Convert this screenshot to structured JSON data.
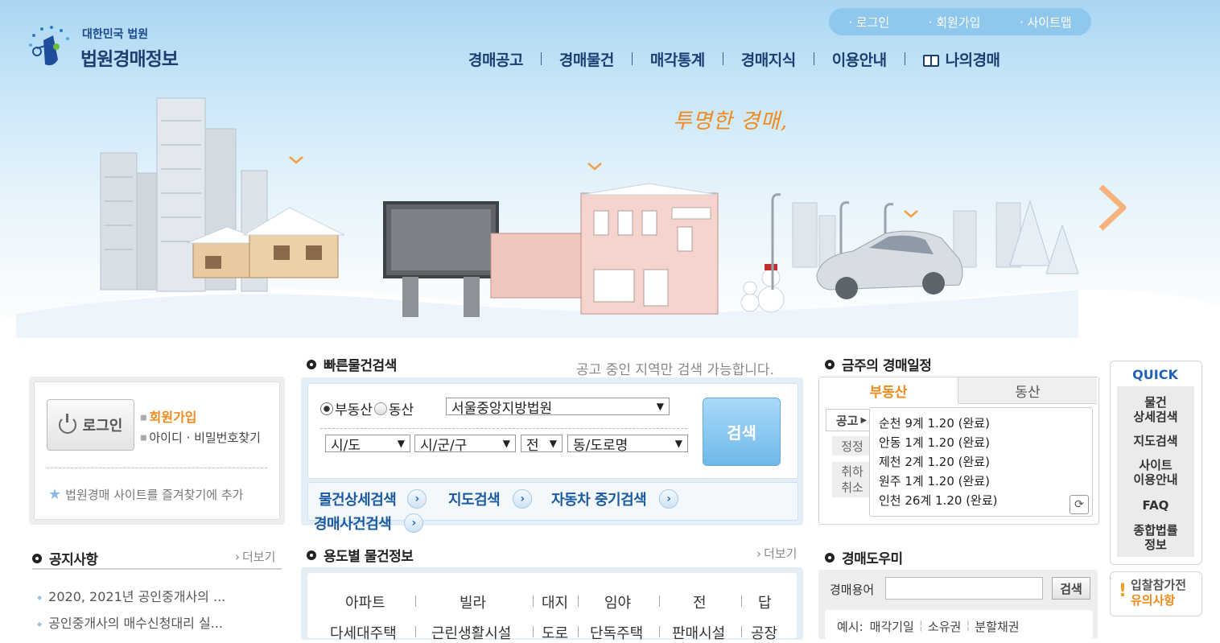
{
  "header": {
    "logo_small": "대한민국 법원",
    "logo_big": "법원경매정보",
    "util_links": [
      "· 로그인",
      "· 회원가입",
      "· 사이트맵"
    ],
    "nav": [
      "경매공고",
      "경매물건",
      "매각통계",
      "경매지식",
      "이용안내",
      "나의경매"
    ]
  },
  "hero": {
    "tagline": "투명한 경매,"
  },
  "login": {
    "button": "로그인",
    "join": "회원가입",
    "find": "아이디 · 비밀번호찾기",
    "favorite": "법원경매 사이트를 즐겨찾기에 추가"
  },
  "quick_search": {
    "title": "빠른물건검색",
    "note": "공고 중인 지역만 검색 가능합니다.",
    "radio_realestate": "부동산",
    "radio_movable": "동산",
    "court_value": "서울중앙지방법원",
    "sido": "시/도",
    "sigungu": "시/군/구",
    "jeon": "전",
    "dong": "동/도로명",
    "search_button": "검색",
    "links": [
      "물건상세검색",
      "지도검색",
      "자동차 중기검색",
      "경매사건검색"
    ]
  },
  "notice": {
    "title": "공지사항",
    "more": "더보기",
    "items": [
      "2020, 2021년 공인중개사의 ...",
      "공인중개사의 매수신청대리 실..."
    ]
  },
  "usage": {
    "title": "용도별 물건정보",
    "more": "더보기",
    "row1": [
      "아파트",
      "빌라",
      "대지",
      "임야",
      "전",
      "답"
    ],
    "row2": [
      "다세대주택",
      "근린생활시설",
      "도로",
      "단독주택",
      "판매시설",
      "공장"
    ]
  },
  "schedule": {
    "title": "금주의 경매일정",
    "tabs": [
      "부동산",
      "동산"
    ],
    "side_labels": [
      "공고",
      "정정",
      "취하",
      "취소"
    ],
    "items": [
      "순천 9계 1.20 (완료)",
      "안동 1계 1.20 (완료)",
      "제천 2계 1.20 (완료)",
      "원주 1계 1.20 (완료)",
      "인천 26계 1.20 (완료)"
    ]
  },
  "helper": {
    "title": "경매도우미",
    "label": "경매용어",
    "button": "검색",
    "example_prefix": "예시:",
    "examples": [
      "매각기일",
      "소유권",
      "분할채권"
    ]
  },
  "quick": {
    "title": "QUICK",
    "items": [
      "물건\n상세검색",
      "지도검색",
      "사이트\n이용안내",
      "FAQ",
      "종합법률\n정보"
    ],
    "notice": [
      "입찰참가전",
      "유의사항"
    ]
  },
  "colors": {
    "nav_text": "#1b3f73",
    "accent_orange": "#f08a1e",
    "link_blue": "#1c5aa0"
  }
}
